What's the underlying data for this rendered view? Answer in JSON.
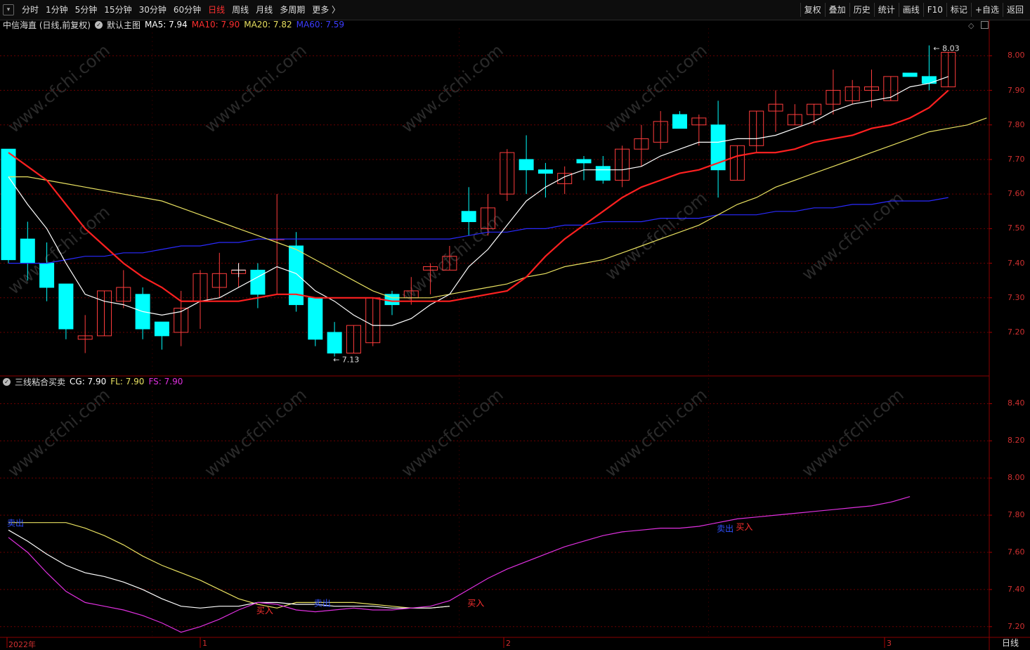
{
  "toolbar": {
    "periods": [
      "分时",
      "1分钟",
      "5分钟",
      "15分钟",
      "30分钟",
      "60分钟",
      "日线",
      "周线",
      "月线",
      "多周期",
      "更多 〉"
    ],
    "active": "日线",
    "right": [
      "复权",
      "叠加",
      "历史",
      "统计",
      "画线",
      "F10",
      "标记",
      "+自选",
      "返回"
    ]
  },
  "main_legend": {
    "name": "中信海直 (日线,前复权)",
    "template": "默认主图",
    "ma5": "MA5: 7.94",
    "ma10": "MA10: 7.90",
    "ma20": "MA20: 7.82",
    "ma60": "MA60: 7.59"
  },
  "sub_legend": {
    "name": "三线粘合买卖",
    "cg": "CG: 7.90",
    "fl": "FL: 7.90",
    "fs": "FS: 7.90"
  },
  "annotations": {
    "high": "8.03",
    "low": "7.13"
  },
  "signals": {
    "buy": "买入",
    "sell": "卖出"
  },
  "x_labels": [
    "2022年",
    "1",
    "2",
    "3"
  ],
  "period_badge": "日线",
  "watermark": "www.cfchi.com",
  "colors": {
    "up": "#ff3c3c",
    "down": "#00ffff",
    "ma5": "#ffffff",
    "ma10": "#ff2020",
    "ma20": "#e8e060",
    "ma60": "#2a2aff",
    "cg": "#ffffff",
    "fl": "#e8e060",
    "fs": "#e030e0",
    "grid": "#6a0000"
  },
  "chart_data": [
    {
      "type": "candlestick",
      "title": "中信海直 (日线,前复权)",
      "ylim": [
        7.08,
        8.08
      ],
      "y_ticks": [
        7.2,
        7.3,
        7.4,
        7.5,
        7.6,
        7.7,
        7.8,
        7.9,
        8.0
      ],
      "candles": [
        {
          "o": 7.73,
          "h": 7.73,
          "l": 7.4,
          "c": 7.41
        },
        {
          "o": 7.47,
          "h": 7.52,
          "l": 7.35,
          "c": 7.4
        },
        {
          "o": 7.4,
          "h": 7.46,
          "l": 7.29,
          "c": 7.33
        },
        {
          "o": 7.34,
          "h": 7.34,
          "l": 7.18,
          "c": 7.21
        },
        {
          "o": 7.18,
          "h": 7.25,
          "l": 7.14,
          "c": 7.19
        },
        {
          "o": 7.19,
          "h": 7.32,
          "l": 7.19,
          "c": 7.32
        },
        {
          "o": 7.29,
          "h": 7.38,
          "l": 7.27,
          "c": 7.33
        },
        {
          "o": 7.31,
          "h": 7.33,
          "l": 7.18,
          "c": 7.21
        },
        {
          "o": 7.23,
          "h": 7.23,
          "l": 7.15,
          "c": 7.19
        },
        {
          "o": 7.2,
          "h": 7.32,
          "l": 7.16,
          "c": 7.27
        },
        {
          "o": 7.29,
          "h": 7.38,
          "l": 7.21,
          "c": 7.37
        },
        {
          "o": 7.33,
          "h": 7.43,
          "l": 7.3,
          "c": 7.37
        },
        {
          "o": 7.37,
          "h": 7.4,
          "l": 7.33,
          "c": 7.38
        },
        {
          "o": 7.38,
          "h": 7.4,
          "l": 7.27,
          "c": 7.31
        },
        {
          "o": 7.47,
          "h": 7.6,
          "l": 7.31,
          "c": 7.47
        },
        {
          "o": 7.45,
          "h": 7.49,
          "l": 7.26,
          "c": 7.28
        },
        {
          "o": 7.3,
          "h": 7.3,
          "l": 7.16,
          "c": 7.18
        },
        {
          "o": 7.2,
          "h": 7.23,
          "l": 7.13,
          "c": 7.14
        },
        {
          "o": 7.14,
          "h": 7.22,
          "l": 7.14,
          "c": 7.22
        },
        {
          "o": 7.17,
          "h": 7.3,
          "l": 7.16,
          "c": 7.3
        },
        {
          "o": 7.31,
          "h": 7.32,
          "l": 7.25,
          "c": 7.28
        },
        {
          "o": 7.3,
          "h": 7.36,
          "l": 7.28,
          "c": 7.32
        },
        {
          "o": 7.38,
          "h": 7.4,
          "l": 7.31,
          "c": 7.39
        },
        {
          "o": 7.38,
          "h": 7.45,
          "l": 7.38,
          "c": 7.42
        },
        {
          "o": 7.55,
          "h": 7.62,
          "l": 7.48,
          "c": 7.52
        },
        {
          "o": 7.5,
          "h": 7.6,
          "l": 7.48,
          "c": 7.56
        },
        {
          "o": 7.6,
          "h": 7.73,
          "l": 7.58,
          "c": 7.72
        },
        {
          "o": 7.7,
          "h": 7.77,
          "l": 7.6,
          "c": 7.67
        },
        {
          "o": 7.67,
          "h": 7.69,
          "l": 7.59,
          "c": 7.66
        },
        {
          "o": 7.63,
          "h": 7.68,
          "l": 7.6,
          "c": 7.66
        },
        {
          "o": 7.7,
          "h": 7.71,
          "l": 7.64,
          "c": 7.69
        },
        {
          "o": 7.68,
          "h": 7.71,
          "l": 7.63,
          "c": 7.64
        },
        {
          "o": 7.64,
          "h": 7.74,
          "l": 7.62,
          "c": 7.73
        },
        {
          "o": 7.73,
          "h": 7.8,
          "l": 7.68,
          "c": 7.76
        },
        {
          "o": 7.75,
          "h": 7.84,
          "l": 7.73,
          "c": 7.81
        },
        {
          "o": 7.83,
          "h": 7.84,
          "l": 7.79,
          "c": 7.79
        },
        {
          "o": 7.8,
          "h": 7.83,
          "l": 7.74,
          "c": 7.82
        },
        {
          "o": 7.8,
          "h": 7.87,
          "l": 7.59,
          "c": 7.67
        },
        {
          "o": 7.64,
          "h": 7.74,
          "l": 7.64,
          "c": 7.74
        },
        {
          "o": 7.74,
          "h": 7.84,
          "l": 7.72,
          "c": 7.84
        },
        {
          "o": 7.84,
          "h": 7.9,
          "l": 7.78,
          "c": 7.86
        },
        {
          "o": 7.8,
          "h": 7.86,
          "l": 7.8,
          "c": 7.83
        },
        {
          "o": 7.83,
          "h": 7.86,
          "l": 7.8,
          "c": 7.86
        },
        {
          "o": 7.86,
          "h": 7.96,
          "l": 7.83,
          "c": 7.9
        },
        {
          "o": 7.87,
          "h": 7.93,
          "l": 7.86,
          "c": 7.91
        },
        {
          "o": 7.9,
          "h": 7.96,
          "l": 7.85,
          "c": 7.91
        },
        {
          "o": 7.87,
          "h": 7.94,
          "l": 7.87,
          "c": 7.94
        },
        {
          "o": 7.95,
          "h": 7.95,
          "l": 7.94,
          "c": 7.94
        },
        {
          "o": 7.94,
          "h": 8.03,
          "l": 7.9,
          "c": 7.92
        },
        {
          "o": 7.91,
          "h": 8.01,
          "l": 7.91,
          "c": 8.01
        }
      ],
      "series": [
        {
          "name": "MA5",
          "values": [
            7.65,
            7.57,
            7.5,
            7.4,
            7.31,
            7.29,
            7.28,
            7.26,
            7.25,
            7.26,
            7.29,
            7.3,
            7.33,
            7.36,
            7.39,
            7.37,
            7.32,
            7.29,
            7.25,
            7.22,
            7.22,
            7.24,
            7.28,
            7.31,
            7.39,
            7.44,
            7.51,
            7.58,
            7.62,
            7.65,
            7.67,
            7.67,
            7.67,
            7.68,
            7.71,
            7.73,
            7.75,
            7.75,
            7.76,
            7.76,
            7.77,
            7.79,
            7.81,
            7.84,
            7.86,
            7.87,
            7.88,
            7.91,
            7.92,
            7.94
          ]
        },
        {
          "name": "MA10",
          "values": [
            7.72,
            7.68,
            7.64,
            7.57,
            7.5,
            7.45,
            7.4,
            7.36,
            7.33,
            7.29,
            7.29,
            7.29,
            7.29,
            7.3,
            7.31,
            7.31,
            7.3,
            7.3,
            7.3,
            7.3,
            7.29,
            7.29,
            7.29,
            7.29,
            7.3,
            7.31,
            7.32,
            7.36,
            7.42,
            7.47,
            7.51,
            7.55,
            7.59,
            7.62,
            7.64,
            7.66,
            7.67,
            7.69,
            7.71,
            7.72,
            7.72,
            7.73,
            7.75,
            7.76,
            7.77,
            7.79,
            7.8,
            7.82,
            7.85,
            7.9
          ]
        },
        {
          "name": "MA20",
          "values": [
            7.65,
            7.65,
            7.64,
            7.63,
            7.62,
            7.61,
            7.6,
            7.59,
            7.58,
            7.56,
            7.54,
            7.52,
            7.5,
            7.48,
            7.46,
            7.44,
            7.41,
            7.38,
            7.35,
            7.32,
            7.3,
            7.3,
            7.3,
            7.31,
            7.32,
            7.33,
            7.34,
            7.36,
            7.37,
            7.39,
            7.4,
            7.41,
            7.43,
            7.45,
            7.47,
            7.49,
            7.51,
            7.54,
            7.57,
            7.59,
            7.62,
            7.64,
            7.66,
            7.68,
            7.7,
            7.72,
            7.74,
            7.76,
            7.78,
            7.79,
            7.8,
            7.82
          ]
        },
        {
          "name": "MA60",
          "values": [
            7.4,
            7.4,
            7.4,
            7.41,
            7.42,
            7.42,
            7.43,
            7.43,
            7.44,
            7.45,
            7.45,
            7.46,
            7.46,
            7.47,
            7.47,
            7.47,
            7.47,
            7.47,
            7.47,
            7.47,
            7.47,
            7.47,
            7.47,
            7.47,
            7.48,
            7.49,
            7.49,
            7.5,
            7.5,
            7.51,
            7.51,
            7.52,
            7.52,
            7.52,
            7.53,
            7.53,
            7.53,
            7.54,
            7.54,
            7.54,
            7.55,
            7.55,
            7.56,
            7.56,
            7.57,
            7.57,
            7.58,
            7.58,
            7.58,
            7.59
          ]
        }
      ]
    },
    {
      "type": "line",
      "title": "三线粘合买卖",
      "ylim": [
        7.15,
        8.5
      ],
      "y_ticks": [
        7.2,
        7.4,
        7.6,
        7.8,
        8.0,
        8.2,
        8.4
      ],
      "series": [
        {
          "name": "CG",
          "values": [
            7.72,
            7.66,
            7.59,
            7.53,
            7.49,
            7.47,
            7.44,
            7.4,
            7.35,
            7.31,
            7.3,
            7.31,
            7.31,
            7.33,
            7.33,
            7.32,
            7.32,
            7.31,
            7.31,
            7.31,
            7.3,
            7.3,
            7.3,
            7.31
          ]
        },
        {
          "name": "FL",
          "values": [
            7.76,
            7.76,
            7.76,
            7.76,
            7.73,
            7.69,
            7.64,
            7.58,
            7.53,
            7.49,
            7.45,
            7.4,
            7.35,
            7.32,
            7.3,
            7.33,
            7.33,
            7.33,
            7.33,
            7.32,
            7.31,
            7.3,
            7.3,
            7.31
          ]
        },
        {
          "name": "FS",
          "values": [
            7.68,
            7.6,
            7.49,
            7.39,
            7.33,
            7.31,
            7.29,
            7.26,
            7.22,
            7.17,
            7.2,
            7.24,
            7.29,
            7.33,
            7.32,
            7.29,
            7.28,
            7.29,
            7.3,
            7.29,
            7.29,
            7.3,
            7.31,
            7.34,
            7.4,
            7.46,
            7.51,
            7.55,
            7.59,
            7.63,
            7.66,
            7.69,
            7.71,
            7.72,
            7.73,
            7.73,
            7.74,
            7.76,
            7.78,
            7.79,
            7.8,
            7.81,
            7.82,
            7.83,
            7.84,
            7.85,
            7.87,
            7.9
          ]
        }
      ],
      "signals": [
        {
          "type": "卖出",
          "i": 0,
          "v": 7.76
        },
        {
          "type": "买入",
          "i": 13,
          "v": 7.29
        },
        {
          "type": "卖出",
          "i": 16,
          "v": 7.33
        },
        {
          "type": "买入",
          "i": 24,
          "v": 7.33
        },
        {
          "type": "卖出",
          "i": 37,
          "v": 7.73
        },
        {
          "type": "买入",
          "i": 38,
          "v": 7.74
        }
      ]
    }
  ]
}
